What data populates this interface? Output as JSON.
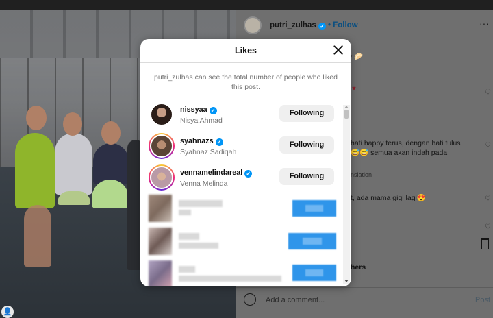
{
  "background_post": {
    "username": "putri_zulhas",
    "follow_label": "Follow",
    "separator": "•",
    "more_label": "···",
    "caption_fragments": [
      "y 🥟",
      "hati happy terus, dengan hati tulus",
      "😅😅 semua akan indah pada",
      "nslation",
      "t, ada mama gigi lagi😍",
      "hers"
    ],
    "add_comment_placeholder": "Add a comment...",
    "post_label": "Post"
  },
  "likes_modal": {
    "title": "Likes",
    "note": "putri_zulhas can see the total number of people who liked this post.",
    "users": [
      {
        "username": "nissyaa",
        "full_name": "Nisya Ahmad",
        "verified": true,
        "button": "Following",
        "story_ring": false
      },
      {
        "username": "syahnazs",
        "full_name": "Syahnaz Sadiqah",
        "verified": true,
        "button": "Following",
        "story_ring": true
      },
      {
        "username": "vennamelindareal",
        "full_name": "Venna Melinda",
        "verified": true,
        "button": "Following",
        "story_ring": true
      }
    ]
  },
  "colors": {
    "accent_blue": "#0095f6",
    "button_gray": "#efefef",
    "overlay_dim": "#6f6f6f"
  },
  "icons": {
    "close": "close-icon",
    "verified": "verified-badge-icon",
    "emoji": "emoji-icon",
    "bookmark": "bookmark-icon",
    "heart": "heart-icon"
  }
}
